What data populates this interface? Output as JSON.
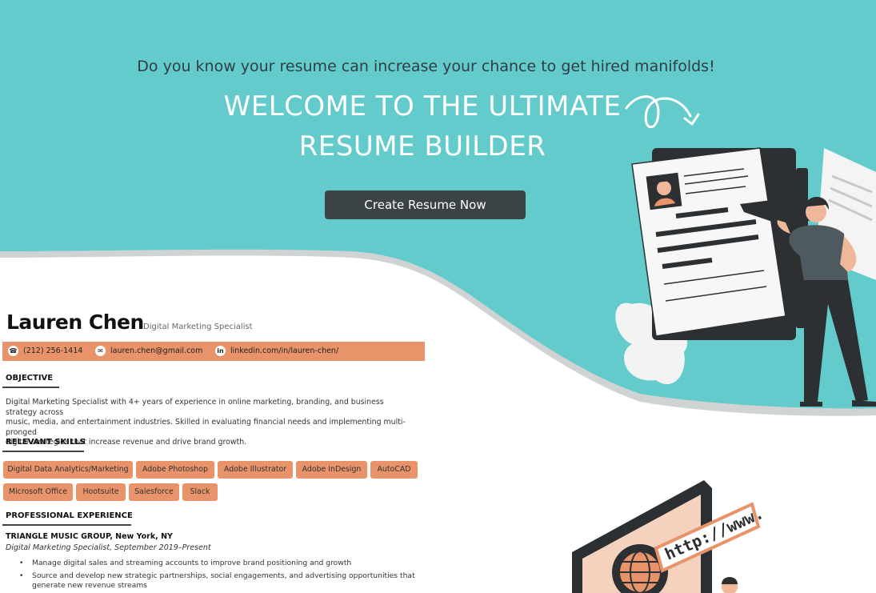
{
  "hero": {
    "tagline": "Do you know your resume can increase your chance to get hired manifolds!",
    "headline_line1": "WELCOME TO THE ULTIMATE",
    "headline_line2": "RESUME BUILDER",
    "cta_label": "Create Resume Now",
    "bg_color": "#63cbcb",
    "cta_color": "#3b4347"
  },
  "resume": {
    "name": "Lauren Chen",
    "role": "Digital Marketing Specialist",
    "accent_color": "#e8936a",
    "contact": {
      "phone": "(212) 256-1414",
      "email": "lauren.chen@gmail.com",
      "linkedin": "linkedin.com/in/lauren-chen/"
    },
    "objective_title": "OBJECTIVE",
    "objective_line1": "Digital Marketing Specialist with 4+ years of experience in online marketing, branding, and business strategy across",
    "objective_line2": "music, media, and entertainment industries. Skilled in evaluating financial needs and implementing multi-pronged",
    "objective_line3": "digital strategies that increase revenue and drive brand growth.",
    "skills_title": "RELEVANT SKILLS",
    "skills": [
      "Digital Data Analytics/Marketing",
      "Adobe Photoshop",
      "Adobe Illustrator",
      "Adobe InDesign",
      "AutoCAD",
      "Microsoft Office",
      "Hootsuite",
      "Salesforce",
      "Slack"
    ],
    "experience_title": "PROFESSIONAL EXPERIENCE",
    "job_company": "TRIANGLE MUSIC GROUP, New York, NY",
    "job_role": "Digital Marketing Specialist, September 2019–Present",
    "bullets": [
      "Manage digital sales and streaming accounts to improve brand positioning and growth",
      "Source and develop new strategic partnerships, social engagements, and advertising opportunities that generate new revenue streams"
    ]
  },
  "illustration": {
    "url_text": "http://www."
  }
}
